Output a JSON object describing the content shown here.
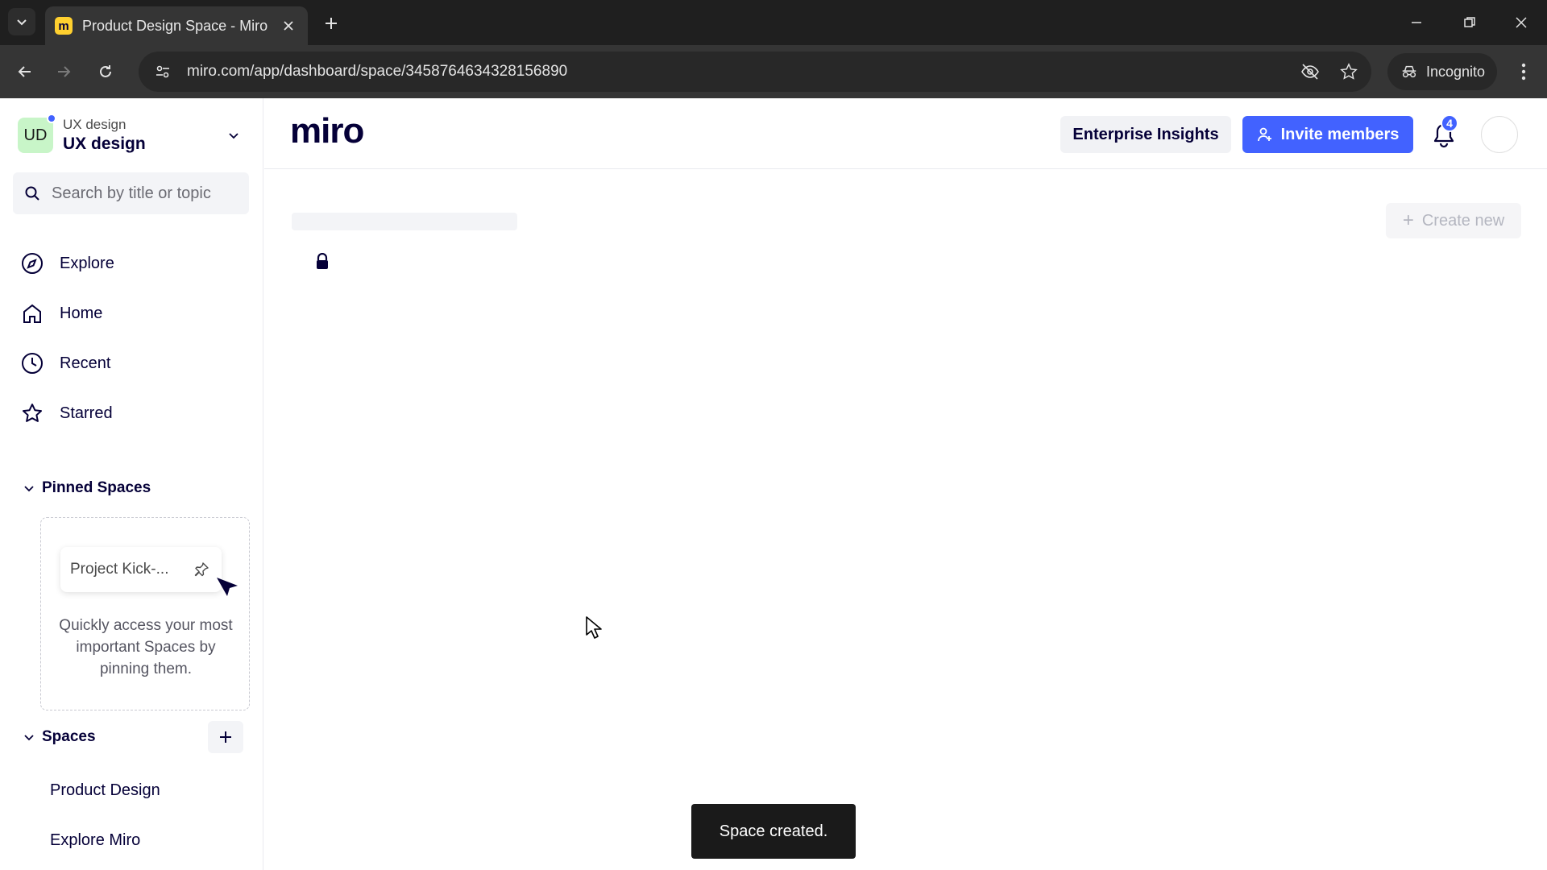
{
  "browser": {
    "tab_title": "Product Design Space - Miro",
    "favicon_letter": "m",
    "url": "miro.com/app/dashboard/space/3458764634328156890",
    "incognito_label": "Incognito"
  },
  "workspace": {
    "avatar_initials": "UD",
    "org_name": "UX design",
    "team_name": "UX design"
  },
  "search": {
    "placeholder": "Search by title or topic"
  },
  "nav": {
    "items": [
      {
        "label": "Explore",
        "icon": "compass-icon"
      },
      {
        "label": "Home",
        "icon": "home-icon"
      },
      {
        "label": "Recent",
        "icon": "clock-icon"
      },
      {
        "label": "Starred",
        "icon": "star-icon"
      }
    ]
  },
  "pinned_spaces": {
    "heading": "Pinned Spaces",
    "example_card": "Project Kick-...",
    "help_text": "Quickly access your most important Spaces by pinning them."
  },
  "spaces": {
    "heading": "Spaces",
    "items": [
      "Product Design",
      "Explore Miro"
    ]
  },
  "header": {
    "logo": "miro",
    "enterprise_insights_label": "Enterprise Insights",
    "invite_label": "Invite members",
    "notification_count": "4"
  },
  "content": {
    "create_new_label": "Create new"
  },
  "toast": {
    "message": "Space created."
  },
  "colors": {
    "accent": "#4262ff",
    "workspace_avatar": "#c8f5c8",
    "brand_yellow": "#ffd02f"
  }
}
